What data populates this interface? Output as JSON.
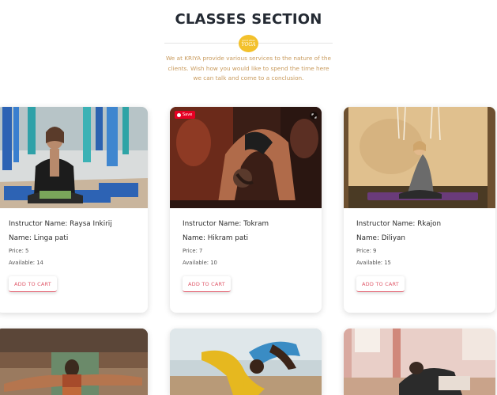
{
  "section": {
    "title": "CLASSES SECTION",
    "logo_small": "good vibes",
    "logo_big": "YOGA",
    "description": "We at KRIYA provide various services to the nature of the clients. Wish how you would like to spend the time here we can talk and come to a conclusion."
  },
  "classes": [
    {
      "instructor": "Instructor Name: Raysa Inkirij",
      "name": "Name: Linga pati",
      "price": "Price: 5",
      "available": "Available: 14",
      "button": "ADD TO CART"
    },
    {
      "instructor": "Instructor Name: Tokram",
      "name": "Name: Hikram pati",
      "price": "Price: 7",
      "available": "Available: 10",
      "button": "ADD TO CART",
      "badge": "Save"
    },
    {
      "instructor": "Instructor Name: Rkajon",
      "name": "Name: Diliyan",
      "price": "Price: 9",
      "available": "Available: 15",
      "button": "ADD TO CART"
    }
  ],
  "icons": {
    "pinterest": "pinterest-save-icon",
    "expand": "expand-icon"
  },
  "colors": {
    "accent": "#e0596a",
    "logo": "#f3c12c",
    "description": "#c89a5c",
    "title": "#242a33"
  }
}
